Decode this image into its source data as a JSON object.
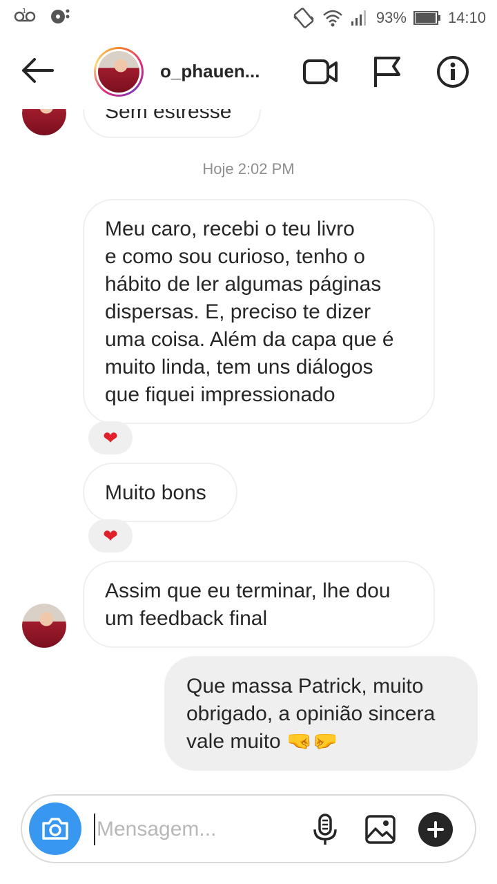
{
  "status_bar": {
    "battery_percent": "93%",
    "time": "14:10"
  },
  "header": {
    "username": "o_phauen..."
  },
  "chat": {
    "top_partial_message": "Sem estresse",
    "timestamp": "Hoje 2:02 PM",
    "messages": [
      {
        "direction": "in",
        "text_lines": [
          "Meu caro, recebi o teu livro",
          "e como sou curioso, tenho o",
          "hábito de ler algumas páginas",
          "dispersas. E, preciso te dizer",
          "uma coisa. Além da capa que é",
          "muito linda, tem uns diálogos",
          "que fiquei impressionado"
        ],
        "reaction": "❤"
      },
      {
        "direction": "in",
        "text_lines": [
          "Muito bons"
        ],
        "reaction": "❤"
      },
      {
        "direction": "in",
        "text_lines": [
          "Assim que eu terminar, lhe dou",
          "um feedback final"
        ]
      },
      {
        "direction": "out",
        "text_lines": [
          "Que massa Patrick, muito",
          "obrigado, a opinião sincera",
          "vale muito 🤜🤛"
        ]
      }
    ]
  },
  "composer": {
    "placeholder": "Mensagem..."
  },
  "colors": {
    "accent": "#3897f0",
    "bubble_border": "#efefef",
    "heart": "#e0202a"
  }
}
